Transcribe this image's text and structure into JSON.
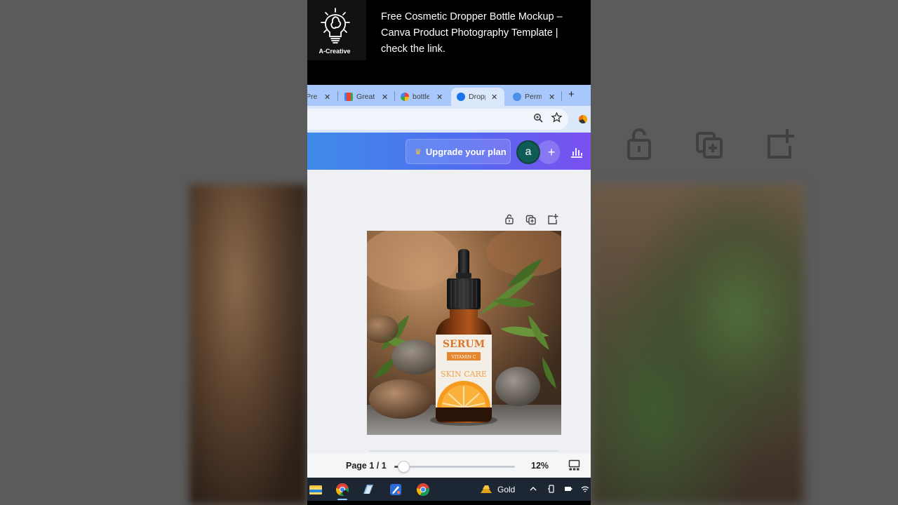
{
  "video": {
    "channel_name": "A-Creative",
    "title": "Free Cosmetic Dropper Bottle Mockup – Canva Product Photography Template | check the link."
  },
  "browser": {
    "tabs": [
      {
        "label": "Pre",
        "active": false,
        "favicon": "generic-tab-icon"
      },
      {
        "label": "Great",
        "active": false,
        "favicon": "gmail-icon"
      },
      {
        "label": "bottle",
        "active": false,
        "favicon": "google-icon"
      },
      {
        "label": "Dropp",
        "active": true,
        "favicon": "canva-icon"
      },
      {
        "label": "Perm",
        "active": false,
        "favicon": "globe-icon"
      }
    ],
    "new_tab_label": "+"
  },
  "canva": {
    "upgrade_label": "Upgrade your plan",
    "avatar_initial": "a",
    "add_label": "+",
    "accent_start": "#3f8be8",
    "accent_end": "#7b4ff0"
  },
  "design": {
    "label_title": "SERUM",
    "label_sub": "VITAMIN C",
    "label_line": "SKIN CARE"
  },
  "footer": {
    "page_label": "Page 1 / 1",
    "zoom_label": "12%",
    "zoom_value": 12
  },
  "taskbar": {
    "gold_label": "Gold"
  }
}
